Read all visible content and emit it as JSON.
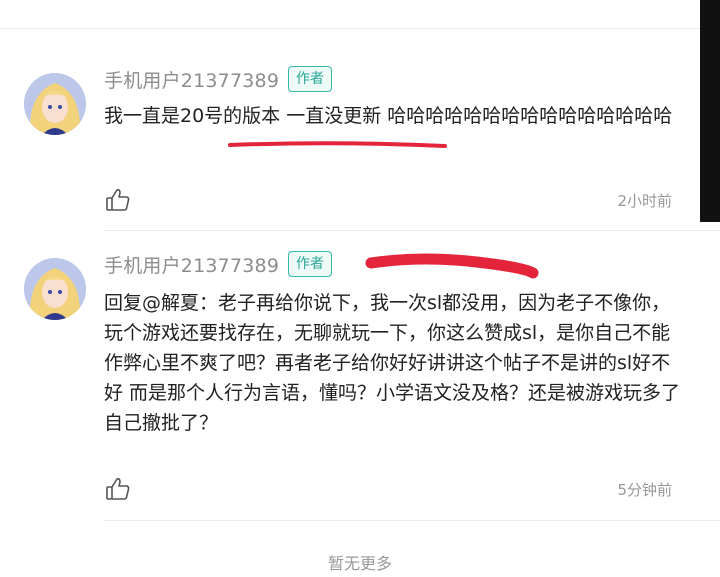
{
  "comments": [
    {
      "username": "手机用户21377389",
      "badge": "作者",
      "content": "我一直是20号的版本 一直没更新 哈哈哈哈哈哈哈哈哈哈哈哈哈哈哈",
      "time": "2小时前"
    },
    {
      "username": "手机用户21377389",
      "badge": "作者",
      "content": "回复@解夏：老子再给你说下，我一次sl都没用，因为老子不像你，玩个游戏还要找存在，无聊就玩一下，你这么赞成sl，是你自己不能作弊心里不爽了吧？再者老子给你好好讲讲这个帖子不是讲的sl好不好 而是那个人行为言语，懂吗？小学语文没及格？还是被游戏玩多了自己撤批了？",
      "time": "5分钟前"
    }
  ],
  "footer": {
    "no_more": "暂无更多"
  },
  "icons": {
    "like": "thumbs-up-icon"
  },
  "colors": {
    "badge": "#2aa898",
    "annotation": "#e3243b"
  }
}
